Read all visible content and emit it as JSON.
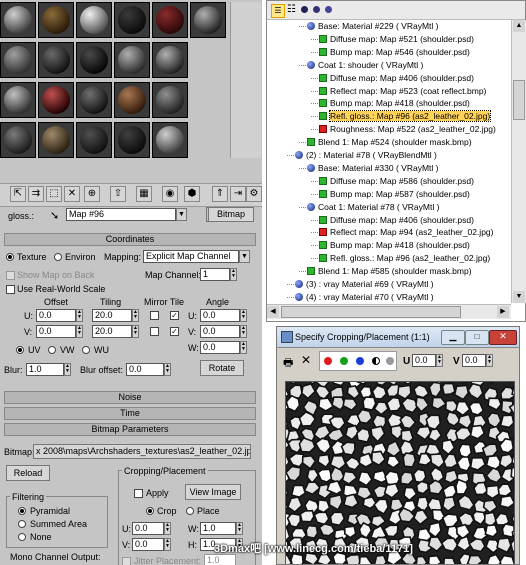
{
  "material_editor": {
    "map_label": "gloss.:",
    "map_name": "Map #96",
    "map_type_button": "Bitmap",
    "coordinates_header": "Coordinates",
    "texture_label": "Texture",
    "environ_label": "Environ",
    "mapping_label": "Mapping:",
    "mapping_value": "Explicit Map Channel",
    "show_map_label": "Show Map on Back",
    "map_channel_label": "Map Channel:",
    "map_channel_value": "1",
    "real_world_label": "Use Real-World Scale",
    "offset_header": "Offset",
    "tiling_header": "Tiling",
    "mirror_tile_header": "Mirror Tile",
    "angle_header": "Angle",
    "u_label": "U:",
    "v_label": "V:",
    "w_label": "W:",
    "offset_u": "0.0",
    "offset_v": "0.0",
    "tiling_u": "20.0",
    "tiling_v": "20.0",
    "angle_u": "0.0",
    "angle_v": "0.0",
    "angle_w": "0.0",
    "uv_label": "UV",
    "vw_label": "VW",
    "wu_label": "WU",
    "blur_label": "Blur:",
    "blur_value": "1.0",
    "blur_offset_label": "Blur offset:",
    "blur_offset_value": "0.0",
    "rotate_button": "Rotate",
    "noise_header": "Noise",
    "time_header": "Time",
    "bitmap_params_header": "Bitmap Parameters",
    "bitmap_label": "Bitmap:",
    "bitmap_path": "x 2008\\maps\\Archshaders_textures\\as2_leather_02.jpg",
    "reload_button": "Reload",
    "crop_group": "Cropping/Placement",
    "apply_label": "Apply",
    "view_image_button": "View Image",
    "crop_label": "Crop",
    "place_label": "Place",
    "crop_u": "0.0",
    "crop_v": "0.0",
    "crop_w": "1.0",
    "crop_h": "1.0",
    "h_label": "H:",
    "jitter_label": "Jitter Placement:",
    "jitter_value": "1.0",
    "filtering_group": "Filtering",
    "pyramidal_label": "Pyramidal",
    "summed_area_label": "Summed Area",
    "none_label": "None",
    "mono_channel_label": "Mono Channel Output:"
  },
  "tree": {
    "rows": [
      {
        "kind": "ball",
        "indent": 40,
        "text": "Base: Material #229  ( VRayMtl )"
      },
      {
        "kind": "green",
        "indent": 52,
        "text": "Diffuse map: Map #521 (shoulder.psd)"
      },
      {
        "kind": "green",
        "indent": 52,
        "text": "Bump map: Map #546 (shoulder.psd)"
      },
      {
        "kind": "ball",
        "indent": 40,
        "text": "Coat 1: shouder  ( VRayMtl )"
      },
      {
        "kind": "green",
        "indent": 52,
        "text": "Diffuse map: Map #406 (shoulder.psd)"
      },
      {
        "kind": "green",
        "indent": 52,
        "text": "Reflect map: Map #523 (coat reflect.bmp)"
      },
      {
        "kind": "green",
        "indent": 52,
        "text": "Bump map: Map #418 (shoulder.psd)"
      },
      {
        "kind": "green",
        "indent": 52,
        "text": "Refl. gloss.: Map #96 (as2_leather_02.jpg)",
        "highlight": true
      },
      {
        "kind": "red",
        "indent": 52,
        "text": "Roughness: Map #522 (as2_leather_02.jpg)"
      },
      {
        "kind": "green",
        "indent": 40,
        "text": "Blend 1: Map #524 (shoulder mask.bmp)"
      },
      {
        "kind": "ball",
        "indent": 28,
        "text": "(2) : Material #78  ( VRayBlendMtl )"
      },
      {
        "kind": "ball",
        "indent": 40,
        "text": "Base: Material #330  ( VRayMtl )"
      },
      {
        "kind": "green",
        "indent": 52,
        "text": "Diffuse map: Map #586 (shoulder.psd)"
      },
      {
        "kind": "green",
        "indent": 52,
        "text": "Bump map: Map #587 (shoulder.psd)"
      },
      {
        "kind": "ball",
        "indent": 40,
        "text": "Coat 1: Material #78  ( VRayMtl )"
      },
      {
        "kind": "green",
        "indent": 52,
        "text": "Diffuse map: Map #406 (shoulder.psd)"
      },
      {
        "kind": "red",
        "indent": 52,
        "text": "Reflect map: Map #94 (as2_leather_02.jpg)"
      },
      {
        "kind": "green",
        "indent": 52,
        "text": "Bump map: Map #418 (shoulder.psd)"
      },
      {
        "kind": "green",
        "indent": 52,
        "text": "Refl. gloss.: Map #96 (as2_leather_02.jpg)"
      },
      {
        "kind": "green",
        "indent": 40,
        "text": "Blend 1: Map #585 (shoulder mask.bmp)"
      },
      {
        "kind": "ball",
        "indent": 28,
        "text": "(3) : vray Material #69  ( VRayMtl )"
      },
      {
        "kind": "ball",
        "indent": 28,
        "text": "(4) : vray Material #70  ( VRayMtl )"
      }
    ]
  },
  "crop_window": {
    "title": "Specify Cropping/Placement (1:1)",
    "u_label": "U",
    "u_value": "0.0",
    "v_label": "V",
    "v_value": "0.0"
  },
  "watermark": "3Dmax吧  [www.linecg.com/tieba/1171]",
  "colors": {
    "panel": "#c5c5c5",
    "highlight": "#ffd25a",
    "title_blue": "#0a246a"
  }
}
